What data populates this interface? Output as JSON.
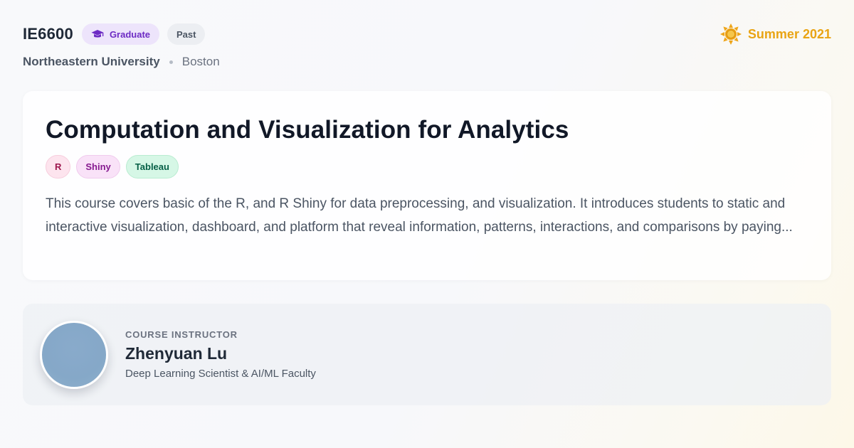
{
  "header": {
    "course_code": "IE6600",
    "level_badge": "Graduate",
    "status_badge": "Past",
    "university": "Northeastern University",
    "city": "Boston",
    "term": "Summer 2021",
    "icons": {
      "level": "graduation-cap-icon",
      "term": "sun-icon"
    }
  },
  "course": {
    "title": "Computation and Visualization for Analytics",
    "tags": [
      "R",
      "Shiny",
      "Tableau"
    ],
    "description": "This course covers basic of the R, and R Shiny for data preprocessing, and visualization. It introduces students to static and interactive visualization, dashboard, and platform that reveal information, patterns, interactions, and comparisons by paying..."
  },
  "instructor": {
    "label": "COURSE INSTRUCTOR",
    "name": "Zhenyuan Lu",
    "role": "Deep Learning Scientist & AI/ML Faculty"
  },
  "colors": {
    "graduate_badge": "#ede4fb",
    "term_accent": "#e9a414",
    "tag_r": "#fde4ee",
    "tag_shiny": "#f9e2f8",
    "tag_tableau": "#d6f7e6"
  }
}
